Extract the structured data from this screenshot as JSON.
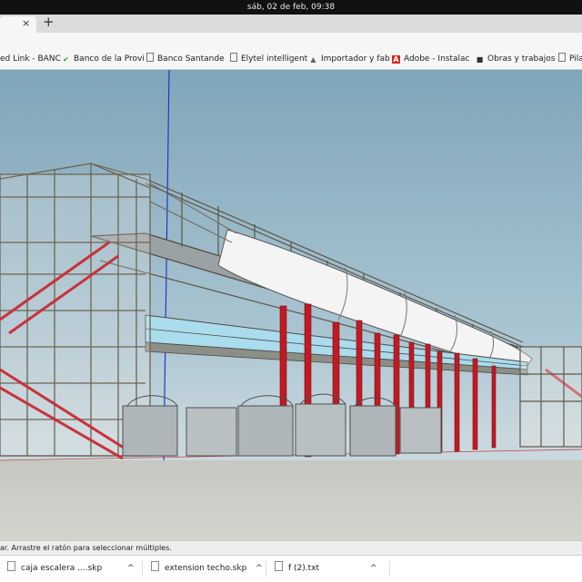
{
  "system": {
    "clock": "sáb, 02 de feb, 09:38"
  },
  "browser": {
    "tab_close_glyph": "×",
    "new_tab_glyph": "+",
    "bookmarks": [
      {
        "label": "ed Link - BANC",
        "icon": "link-icon"
      },
      {
        "label": "Banco de la Provi",
        "icon": "bank-icon"
      },
      {
        "label": "Banco Santande",
        "icon": "page-icon"
      },
      {
        "label": "Elytel intelligent",
        "icon": "page-icon"
      },
      {
        "label": "Importador y fab",
        "icon": "triangle-icon"
      },
      {
        "label": "Adobe - Instalac",
        "icon": "adobe-icon"
      },
      {
        "label": "Obras y trabajos",
        "icon": "tool-icon"
      },
      {
        "label": "Pila",
        "icon": "page-icon"
      }
    ]
  },
  "status_bar": {
    "text": "ar. Arrastre el ratón para seleccionar múltiples."
  },
  "downloads": [
    {
      "filename": "caja escalera ....skp",
      "caret": "^"
    },
    {
      "filename": "extension techo.skp",
      "caret": "^"
    },
    {
      "filename": "f (2).txt",
      "caret": "^"
    }
  ],
  "colors": {
    "sky": "#8fb3c4",
    "ground": "#cfcfca",
    "steel": "#8a8468",
    "column_red": "#c01a24",
    "stair_red": "#c8323c",
    "glass": "#9fd3e6"
  }
}
